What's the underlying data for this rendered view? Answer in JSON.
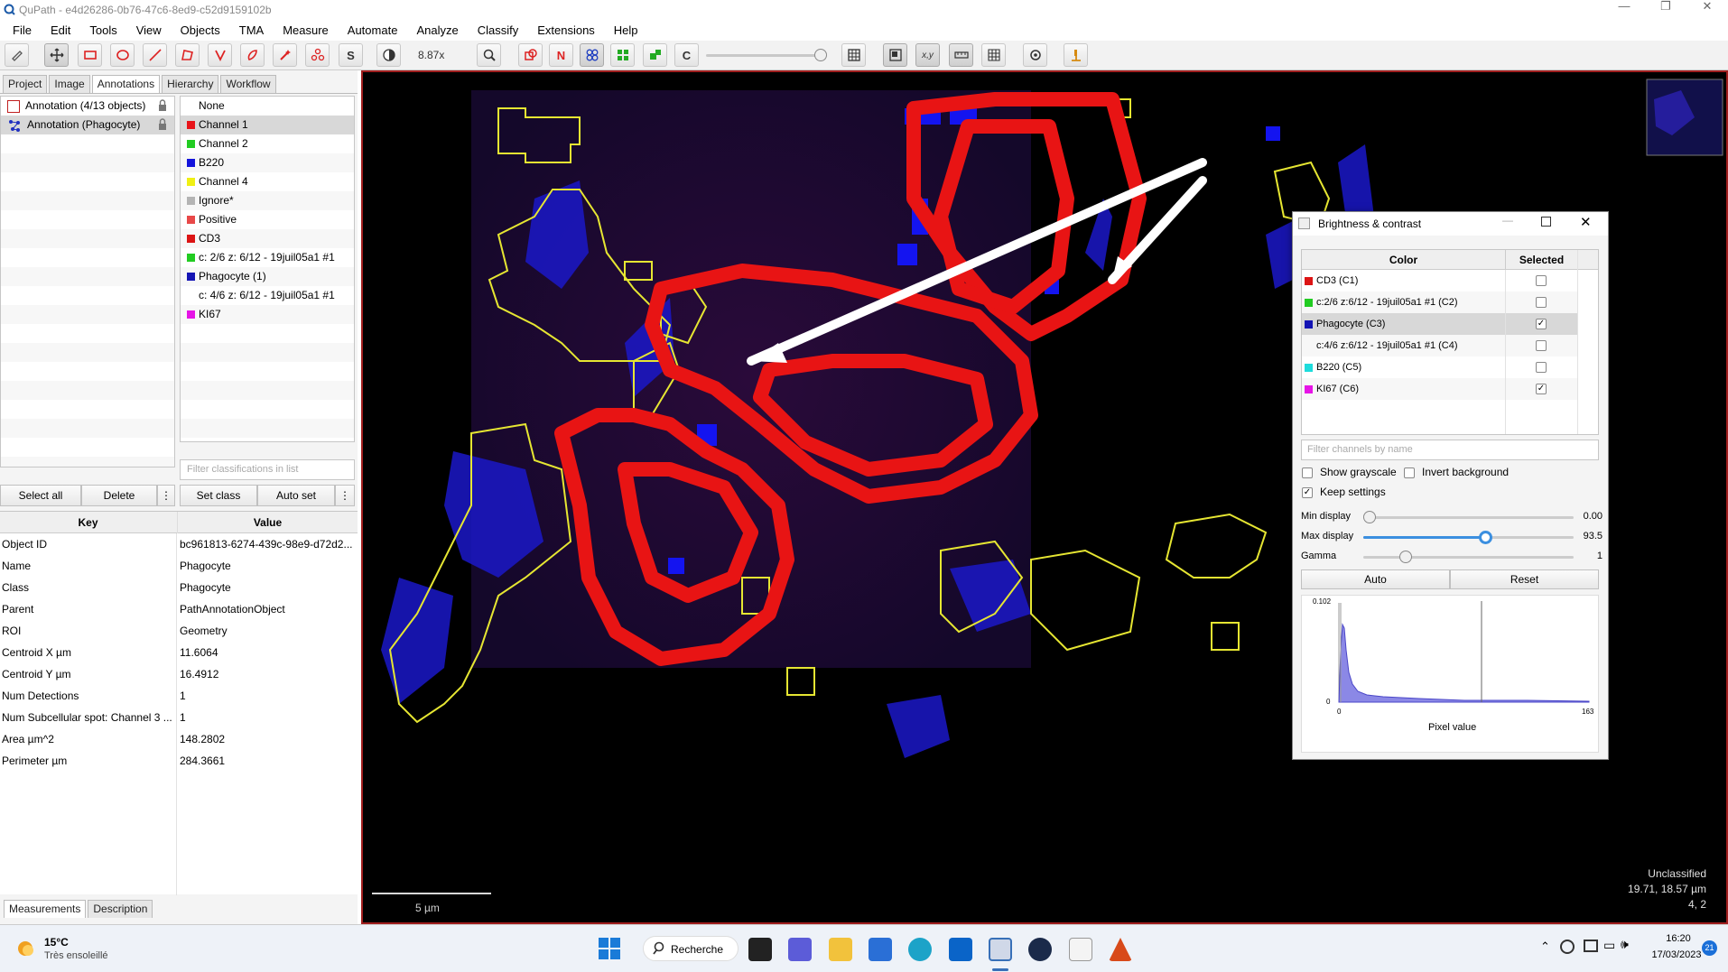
{
  "window": {
    "title": "QuPath - e4d26286-0b76-47c6-8ed9-c52d9159102b",
    "controls": [
      "—",
      "❐",
      "✕"
    ]
  },
  "menu": [
    "File",
    "Edit",
    "Tools",
    "View",
    "Objects",
    "TMA",
    "Measure",
    "Automate",
    "Analyze",
    "Classify",
    "Extensions",
    "Help"
  ],
  "toolbar": {
    "zoom": "8.87x",
    "letter_buttons": {
      "s": "S",
      "n": "N",
      "c": "C",
      "xy": "x,y"
    }
  },
  "left_tabs": [
    "Project",
    "Image",
    "Annotations",
    "Hierarchy",
    "Workflow"
  ],
  "annotations": [
    {
      "label": "Annotation (4/13 objects)"
    },
    {
      "label": "Annotation (Phagocyte)"
    }
  ],
  "classes": [
    {
      "name": "None",
      "color": null
    },
    {
      "name": "Channel 1",
      "color": "#e8141a",
      "selected": true
    },
    {
      "name": "Channel 2",
      "color": "#22cc22"
    },
    {
      "name": "B220",
      "color": "#1414dc"
    },
    {
      "name": "Channel 4",
      "color": "#f0f014"
    },
    {
      "name": "Ignore*",
      "color": "#b4b4b4"
    },
    {
      "name": "Positive",
      "color": "#e84848"
    },
    {
      "name": "CD3",
      "color": "#dc1414"
    },
    {
      "name": "c: 2/6 z: 6/12 - 19juil05a1 #1",
      "color": "#22cc22"
    },
    {
      "name": "Phagocyte (1)",
      "color": "#1414b4"
    },
    {
      "name": "c: 4/6 z: 6/12 - 19juil05a1 #1",
      "color": null
    },
    {
      "name": "KI67",
      "color": "#e614e6"
    }
  ],
  "filter_placeholder": "Filter classifications in list",
  "buttons": {
    "select_all": "Select all",
    "delete": "Delete",
    "set_class": "Set class",
    "auto_set": "Auto set",
    "more": "⋮"
  },
  "measure_table": {
    "headers": [
      "Key",
      "Value"
    ],
    "rows": [
      {
        "key": "Object ID",
        "value": "bc961813-6274-439c-98e9-d72d2..."
      },
      {
        "key": "Name",
        "value": "Phagocyte"
      },
      {
        "key": "Class",
        "value": "Phagocyte"
      },
      {
        "key": "Parent",
        "value": "PathAnnotationObject"
      },
      {
        "key": "ROI",
        "value": "Geometry"
      },
      {
        "key": "Centroid X µm",
        "value": "11.6064"
      },
      {
        "key": "Centroid Y µm",
        "value": "16.4912"
      },
      {
        "key": "Num Detections",
        "value": "1"
      },
      {
        "key": "Num Subcellular spot: Channel 3 ...",
        "value": "1"
      },
      {
        "key": "Area µm^2",
        "value": "148.2802"
      },
      {
        "key": "Perimeter µm",
        "value": "284.3661"
      }
    ]
  },
  "bottom_tabs": [
    "Measurements",
    "Description"
  ],
  "viewer": {
    "scalebar": "5 µm",
    "status": {
      "line1": "Unclassified",
      "line2": "19.71, 18.57 µm",
      "line3": "4, 2"
    }
  },
  "bc_dialog": {
    "title": "Brightness & contrast",
    "header_color": "Color",
    "header_selected": "Selected",
    "channels": [
      {
        "name": "CD3 (C1)",
        "color": "#dc1414",
        "checked": false
      },
      {
        "name": "c:2/6 z:6/12 - 19juil05a1 #1 (C2)",
        "color": "#22cc22",
        "checked": false
      },
      {
        "name": "Phagocyte (C3)",
        "color": "#1414b4",
        "checked": true
      },
      {
        "name": "c:4/6 z:6/12 - 19juil05a1 #1 (C4)",
        "color": null,
        "checked": false
      },
      {
        "name": "B220 (C5)",
        "color": "#1edcdc",
        "checked": false
      },
      {
        "name": "KI67 (C6)",
        "color": "#e614e6",
        "checked": true
      }
    ],
    "filter_placeholder": "Filter channels by name",
    "show_grayscale": "Show grayscale",
    "invert_background": "Invert background",
    "keep_settings": "Keep settings",
    "keep_settings_checked": true,
    "min_label": "Min display",
    "min_value": "0.00",
    "max_label": "Max display",
    "max_value": "93.5",
    "gamma_label": "Gamma",
    "gamma_value": "1",
    "auto": "Auto",
    "reset": "Reset",
    "hist_ymax": "0.102",
    "hist_y0": "0",
    "hist_x0": "0",
    "hist_xmax": "163",
    "hist_xlabel": "Pixel value"
  },
  "taskbar": {
    "weather_temp": "15°C",
    "weather_desc": "Très ensoleillé",
    "search": "Recherche",
    "time": "16:20",
    "date": "17/03/2023",
    "notif": "21"
  }
}
